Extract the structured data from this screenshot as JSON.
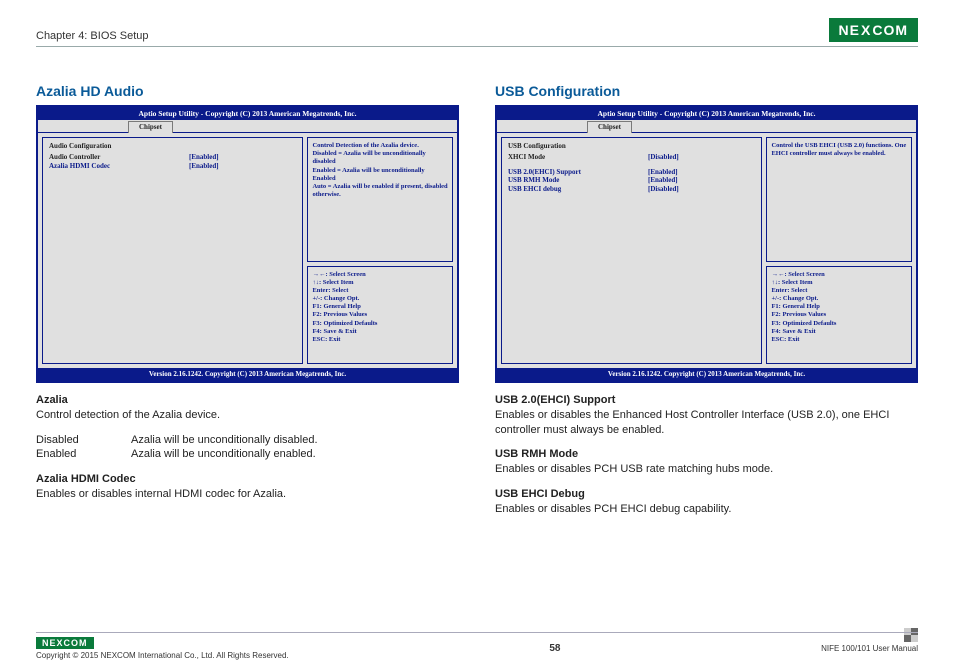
{
  "header": {
    "chapter": "Chapter 4: BIOS Setup",
    "logo": "NEXCOM"
  },
  "left": {
    "title": "Azalia HD Audio",
    "bios": {
      "header": "Aptio Setup Utility - Copyright (C) 2013 American Megatrends, Inc.",
      "tab": "Chipset",
      "section": "Audio Configuration",
      "rows": [
        {
          "label": "Audio Controller",
          "value": "[Enabled]",
          "labelClass": ""
        },
        {
          "label": "Azalia HDMI Codec",
          "value": "[Enabled]",
          "labelClass": "blue"
        }
      ],
      "help": "Control Detection of the Azalia device.\nDisabled = Azalia will be unconditionally disabled\nEnabled = Azalia will be unconditionally Enabled\nAuto = Azalia will be enabled if present, disabled otherwise.",
      "keys": "→←: Select Screen\n↑↓: Select Item\nEnter: Select\n+/-: Change Opt.\nF1: General Help\nF2: Previous Values\nF3: Optimized Defaults\nF4: Save & Exit\nESC: Exit",
      "footer": "Version 2.16.1242. Copyright (C) 2013 American Megatrends, Inc."
    },
    "desc": {
      "h1": "Azalia",
      "p1": "Control detection of the Azalia device.",
      "row1_lbl": "Disabled",
      "row1_txt": "Azalia will be unconditionally disabled.",
      "row2_lbl": "Enabled",
      "row2_txt": "Azalia will be unconditionally enabled.",
      "h2": "Azalia HDMI Codec",
      "p2": "Enables or disables internal HDMI codec for Azalia."
    }
  },
  "right": {
    "title": "USB Configuration",
    "bios": {
      "header": "Aptio Setup Utility - Copyright (C) 2013 American Megatrends, Inc.",
      "tab": "Chipset",
      "section": "USB Configuration",
      "rows": [
        {
          "label": "XHCI Mode",
          "value": "[Disabled]",
          "labelClass": ""
        },
        {
          "label": "",
          "value": "",
          "labelClass": ""
        },
        {
          "label": "USB 2.0(EHCI) Support",
          "value": "[Enabled]",
          "labelClass": "blue"
        },
        {
          "label": "USB RMH Mode",
          "value": "[Enabled]",
          "labelClass": "blue"
        },
        {
          "label": "USB EHCI debug",
          "value": "[Disabled]",
          "labelClass": "blue"
        }
      ],
      "help": "Control the USB EHCI (USB 2.0) functions.  One EHCI controller must always be enabled.",
      "keys": "→←: Select Screen\n↑↓: Select Item\nEnter: Select\n+/-: Change Opt.\nF1: General Help\nF2: Previous Values\nF3: Optimized Defaults\nF4: Save & Exit\nESC: Exit",
      "footer": "Version 2.16.1242. Copyright (C) 2013 American Megatrends, Inc."
    },
    "desc": {
      "h1": "USB 2.0(EHCI) Support",
      "p1": "Enables or disables the Enhanced Host Controller Interface (USB 2.0), one EHCI controller must always be enabled.",
      "h2": "USB RMH Mode",
      "p2": "Enables or disables PCH USB rate matching hubs mode.",
      "h3": "USB EHCI Debug",
      "p3": "Enables or disables PCH EHCI debug capability."
    }
  },
  "footer": {
    "copyright": "Copyright © 2015 NEXCOM International Co., Ltd. All Rights Reserved.",
    "page": "58",
    "manual": "NIFE 100/101 User Manual"
  }
}
